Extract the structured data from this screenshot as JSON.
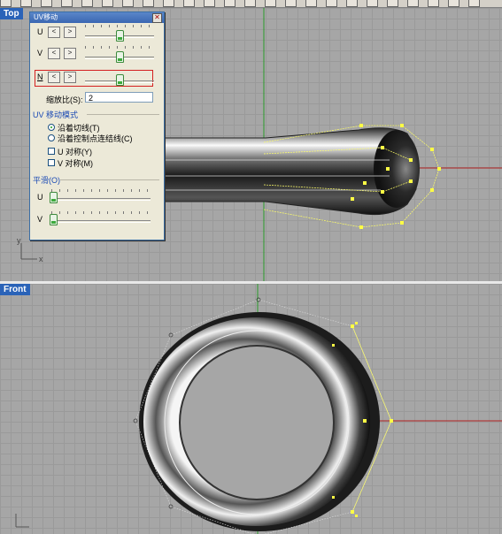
{
  "toolbar": {
    "icons": [
      "tool-icon",
      "tool-icon",
      "tool-icon",
      "tool-icon",
      "tool-icon",
      "tool-icon",
      "tool-icon",
      "tool-icon",
      "tool-icon",
      "tool-icon",
      "tool-icon",
      "tool-icon",
      "tool-icon",
      "tool-icon",
      "tool-icon",
      "tool-icon",
      "tool-icon",
      "tool-icon",
      "tool-icon",
      "tool-icon",
      "tool-icon",
      "tool-icon",
      "tool-icon",
      "tool-icon"
    ]
  },
  "viewports": {
    "top": {
      "label": "Top",
      "axis_x": "x",
      "axis_y": "y"
    },
    "front": {
      "label": "Front"
    }
  },
  "dialog": {
    "title": "UV移动",
    "close_glyph": "✕",
    "u_label": "U",
    "v_label": "V",
    "n_label": "N",
    "btn_left": "<",
    "btn_right": ">",
    "scale_label": "缩放比(S):",
    "scale_value": "2",
    "mode_section": "UV 移动模式",
    "mode_tangent": "沿着切线(T)",
    "mode_control": "沿着控制点连结线(C)",
    "u_sym": "U 对称(Y)",
    "v_sym": "V 对称(M)",
    "smooth_section": "平滑(O)",
    "smooth_u": "U",
    "smooth_v": "V"
  },
  "colors": {
    "viewport_label_bg": "#2a63b8",
    "red_highlight": "#d42020",
    "axis_green": "#2b9b2b",
    "axis_red": "#b02020",
    "control_points": "#ffff44"
  }
}
